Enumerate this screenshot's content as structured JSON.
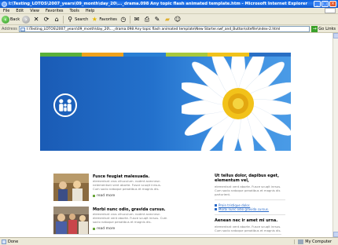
{
  "window": {
    "title": "I:\\Testing_LOTOS\\2007_years\\09_month\\day_20\\..._drama.098 Any topic flash animated template.htm - Microsoft Internet Explorer"
  },
  "menu": [
    "File",
    "Edit",
    "View",
    "Favorites",
    "Tools",
    "Help"
  ],
  "toolbar": {
    "back_label": "Back",
    "search_label": "Search",
    "favorites_label": "Favorites"
  },
  "address": {
    "label": "Address",
    "value": "I:\\Testing_LOTOS\\2007_years\\09_month\\day_20\\..._drama.098 Any topic flash animated template\\New Starter.swf_and_Button\\sitefile\\index-2.html",
    "go_label": "Go",
    "links_label": "Links"
  },
  "status": {
    "text": "Done",
    "zone": "My Computer"
  },
  "site": {
    "colorbar": [
      "#5ab03a",
      "#f0a21c",
      "#2a7fd4",
      "#a8c83c",
      "#f0c21c",
      "#2a6fc4"
    ],
    "hero_colors": {
      "start": "#1a5bb5",
      "end": "#4a9be6"
    },
    "articles": [
      {
        "title": "Fusce feugiat malesuada.",
        "body": "elementsnt cros vihuculum. nodmt acecnnsn nelementsnt vent aborte. Fusce scuqit inrsus. Cum soclo natoque penatibus et magnis dis.",
        "readmore": "read more"
      },
      {
        "title": "Morbi nunc odio, gravida cursus.",
        "body": "elementsnt cros vihuculum. nodmt acecnnsn elementsnt vent aborte. Fusce scuqit inrsus. Cum soclo natoque penatibus et magnis dis.",
        "readmore": "read more"
      }
    ],
    "right": {
      "title": "Ut tellus dolor, dapibus eget, elementum vel,",
      "body": "elementsnt vent aborte. Fusce scuqit inrsus. Cum soclo natoque penatibus et magnis dis parturient.",
      "links": [
        "Proin tristique dolor.",
        "Morbi nunc odio gravida cursus."
      ],
      "title2": "Aenean nec ir amet mi urna.",
      "body2": "elementsnt vent aborte. Fusce scuqit inrsus. Cum soclo natoque penatibus et magnis dis."
    }
  }
}
